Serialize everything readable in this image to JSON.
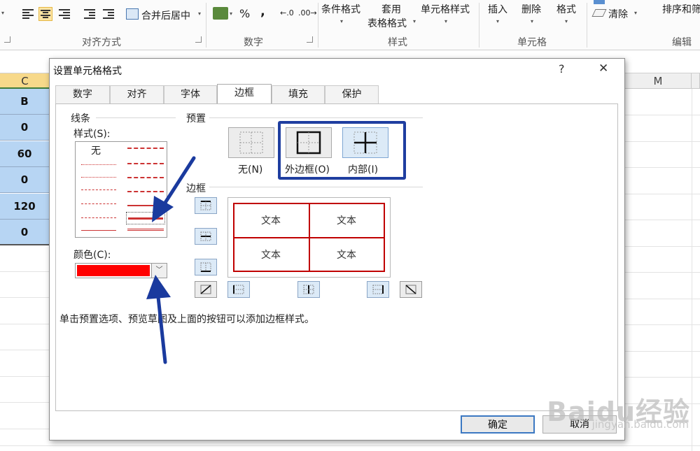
{
  "ribbon": {
    "merge_center": "合并后居中",
    "percent": "%",
    "comma": ",",
    "cond_format": "条件格式",
    "table_format_1": "套用",
    "table_format_2": "表格格式",
    "cell_style": "单元格样式",
    "insert": "插入",
    "delete": "删除",
    "format": "格式",
    "clear": "清除",
    "sort": "排序和筛",
    "groups": {
      "alignment": "对齐方式",
      "number": "数字",
      "styles": "样式",
      "cells": "单元格",
      "editing": "编辑"
    }
  },
  "sheet": {
    "col_c": "C",
    "col_m": "M",
    "cells": [
      "B",
      "0",
      "60",
      "0",
      "120",
      "0"
    ]
  },
  "dialog": {
    "title": "设置单元格格式",
    "help": "?",
    "close": "✕",
    "tabs": [
      "数字",
      "对齐",
      "字体",
      "边框",
      "填充",
      "保护"
    ],
    "active_tab": "边框",
    "line_group": "线条",
    "style_label": "样式(S):",
    "style_none": "无",
    "color_label": "颜色(C):",
    "color_value": "#ff0000",
    "presets_group": "预置",
    "preset_none": "无(N)",
    "preset_outline": "外边框(O)",
    "preset_inside": "内部(I)",
    "border_group": "边框",
    "preview_text": [
      "文本",
      "文本",
      "文本",
      "文本"
    ],
    "hint": "单击预置选项、预览草图及上面的按钮可以添加边框样式。",
    "ok": "确定",
    "cancel": "取消"
  },
  "watermark": {
    "brand": "Baidu经验",
    "url": "jingyan.baidu.com"
  }
}
